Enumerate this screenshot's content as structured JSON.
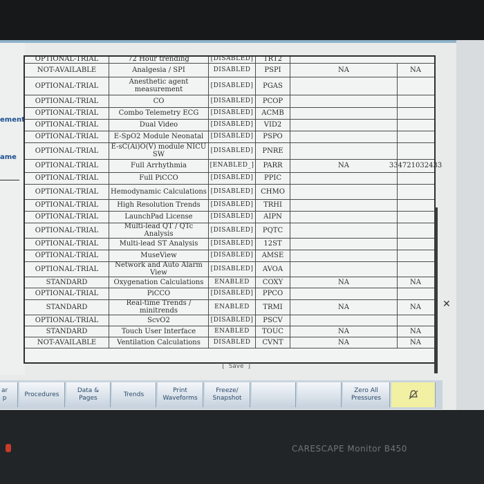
{
  "sidebar": {
    "labels": [
      "ement",
      "ame"
    ]
  },
  "table": {
    "partial_top_row": {
      "status": "OPTIONAL-TRIAL",
      "feature": "72 Hour trending",
      "state": "[DISABLED]",
      "code": "TRT2"
    },
    "rows": [
      {
        "status": "NOT-AVAILABLE",
        "feature": "Analgesia / SPI",
        "state": "DISABLED",
        "code": "PSPI",
        "extra1": "NA",
        "extra2": "NA"
      },
      {
        "status": "OPTIONAL-TRIAL",
        "feature": "Anesthetic agent measurement",
        "state": "[DISABLED]",
        "code": "PGAS",
        "extra1": "",
        "extra2": ""
      },
      {
        "status": "OPTIONAL-TRIAL",
        "feature": "CO",
        "state": "[DISABLED]",
        "code": "PCOP",
        "extra1": "",
        "extra2": ""
      },
      {
        "status": "OPTIONAL-TRIAL",
        "feature": "Combo Telemetry ECG",
        "state": "[DISABLED]",
        "code": "ACMB",
        "extra1": "",
        "extra2": ""
      },
      {
        "status": "OPTIONAL-TRIAL",
        "feature": "Dual Video",
        "state": "[DISABLED]",
        "code": "VID2",
        "extra1": "",
        "extra2": ""
      },
      {
        "status": "OPTIONAL-TRIAL",
        "feature": "E-SpO2 Module Neonatal",
        "state": "[DISABLED]",
        "code": "PSPO",
        "extra1": "",
        "extra2": ""
      },
      {
        "status": "OPTIONAL-TRIAL",
        "feature": "E-sC(Ai)O(V) module NICU SW",
        "state": "[DISABLED]",
        "code": "PNRE",
        "extra1": "",
        "extra2": ""
      },
      {
        "status": "OPTIONAL-TRIAL",
        "feature": "Full Arrhythmia",
        "state": "[ENABLED_]",
        "code": "PARR",
        "extra1": "NA",
        "extra2": "334721032433"
      },
      {
        "status": "OPTIONAL-TRIAL",
        "feature": "Full PiCCO",
        "state": "[DISABLED]",
        "code": "PPIC",
        "extra1": "",
        "extra2": ""
      },
      {
        "status": "OPTIONAL-TRIAL",
        "feature": "Hemodynamic Calculations",
        "state": "[DISABLED]",
        "code": "CHMO",
        "extra1": "",
        "extra2": ""
      },
      {
        "status": "OPTIONAL-TRIAL",
        "feature": "High Resolution Trends",
        "state": "[DISABLED]",
        "code": "TRHI",
        "extra1": "",
        "extra2": ""
      },
      {
        "status": "OPTIONAL-TRIAL",
        "feature": "LaunchPad License",
        "state": "[DISABLED]",
        "code": "AIPN",
        "extra1": "",
        "extra2": ""
      },
      {
        "status": "OPTIONAL-TRIAL",
        "feature": "Multi-lead QT / QTc Analysis",
        "state": "[DISABLED]",
        "code": "PQTC",
        "extra1": "",
        "extra2": ""
      },
      {
        "status": "OPTIONAL-TRIAL",
        "feature": "Multi-lead ST Analysis",
        "state": "[DISABLED]",
        "code": "12ST",
        "extra1": "",
        "extra2": ""
      },
      {
        "status": "OPTIONAL-TRIAL",
        "feature": "MuseView",
        "state": "[DISABLED]",
        "code": "AMSE",
        "extra1": "",
        "extra2": ""
      },
      {
        "status": "OPTIONAL-TRIAL",
        "feature": "Network and Auto Alarm View",
        "state": "[DISABLED]",
        "code": "AVOA",
        "extra1": "",
        "extra2": ""
      },
      {
        "status": "STANDARD",
        "feature": "Oxygenation Calculations",
        "state": "ENABLED",
        "code": "COXY",
        "extra1": "NA",
        "extra2": "NA"
      },
      {
        "status": "OPTIONAL-TRIAL",
        "feature": "PiCCO",
        "state": "[DISABLED]",
        "code": "PPCO",
        "extra1": "",
        "extra2": ""
      },
      {
        "status": "STANDARD",
        "feature": "Real-time Trends / minitrends",
        "state": "ENABLED",
        "code": "TRMI",
        "extra1": "NA",
        "extra2": "NA"
      },
      {
        "status": "OPTIONAL-TRIAL",
        "feature": "ScvO2",
        "state": "[DISABLED]",
        "code": "PSCV",
        "extra1": "",
        "extra2": ""
      },
      {
        "status": "STANDARD",
        "feature": "Touch User Interface",
        "state": "ENABLED",
        "code": "TOUC",
        "extra1": "NA",
        "extra2": "NA"
      },
      {
        "status": "NOT-AVAILABLE",
        "feature": "Ventilation Calculations",
        "state": "DISABLED",
        "code": "CVNT",
        "extra1": "NA",
        "extra2": "NA"
      }
    ]
  },
  "save_label": "[ Save ]",
  "toolbar": {
    "left_partial": "ar\np",
    "buttons": [
      {
        "label": "Procedures",
        "dim": false
      },
      {
        "label": "Data &\nPages",
        "dim": false
      },
      {
        "label": "Trends",
        "dim": false
      },
      {
        "label": "Print\nWaveforms",
        "dim": false
      },
      {
        "label": "Freeze/\nSnapshot",
        "dim": false
      },
      {
        "label": "",
        "dim": true
      },
      {
        "label": "",
        "dim": true
      },
      {
        "label": "Zero All\nPressures",
        "dim": false
      }
    ],
    "alarm_icon": "alarm-bell-icon"
  },
  "device_brand": "CARESCAPE Monitor B450"
}
